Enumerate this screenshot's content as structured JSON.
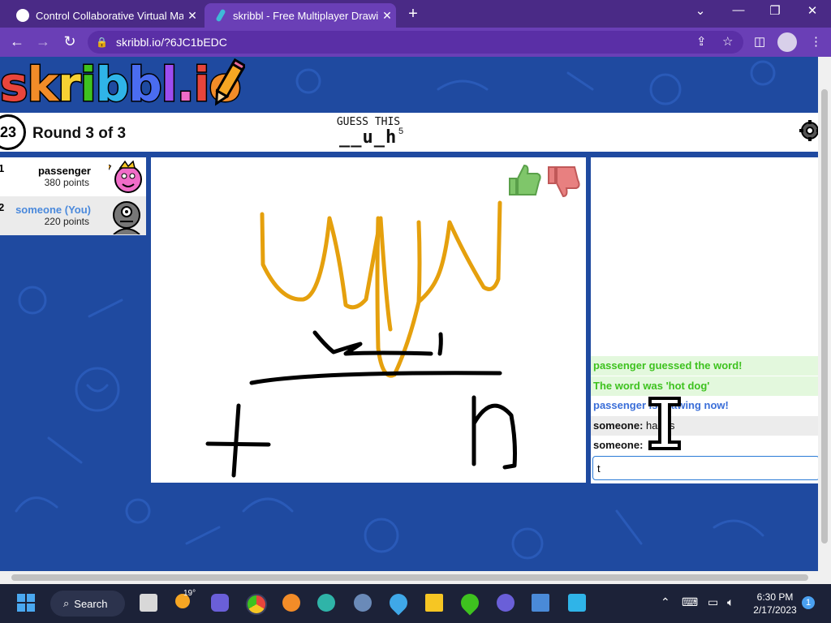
{
  "browser": {
    "tabs": [
      {
        "title": "Control Collaborative Virtual Mac",
        "active": false
      },
      {
        "title": "skribbl - Free Multiplayer Drawin",
        "active": true
      }
    ],
    "url": "skribbl.io/?6JC1bEDC"
  },
  "game": {
    "logo": [
      "s",
      "k",
      "r",
      "i",
      "b",
      "b",
      "l",
      ".",
      "i",
      "o"
    ],
    "timer": "23",
    "round": "Round 3 of 3",
    "guess_label": "GUESS THIS",
    "word_hint": "__u_h",
    "word_length": "5",
    "players": [
      {
        "rank": "1",
        "name": "passenger",
        "points": "380 points",
        "is_you": false
      },
      {
        "rank": "2",
        "name": "someone (You)",
        "points": "220 points",
        "is_you": true
      }
    ],
    "chat": [
      {
        "text": "passenger guessed the word!",
        "style": "correct"
      },
      {
        "text": "The word was 'hot dog'",
        "style": "correct"
      },
      {
        "text": "passenger is drawing now!",
        "style": "info"
      },
      {
        "sender": "someone:",
        "text": "hands",
        "style": "normal"
      },
      {
        "sender": "someone:",
        "text": "",
        "style": "normal"
      }
    ],
    "chat_input": "t"
  },
  "taskbar": {
    "search": "Search",
    "weather": "19°",
    "time": "6:30 PM",
    "date": "2/17/2023",
    "notifications": "1"
  },
  "colors": {
    "tabbar": "#4a2a86",
    "toolbar": "#6a3fb6",
    "page_bg": "#1f4aa0",
    "stroke_orange": "#e5a00d",
    "chat_correct_bg": "#e3f8dd",
    "chat_correct_text": "#3ec21f",
    "chat_info_text": "#3a6ed8",
    "you_text": "#4a89dc"
  }
}
